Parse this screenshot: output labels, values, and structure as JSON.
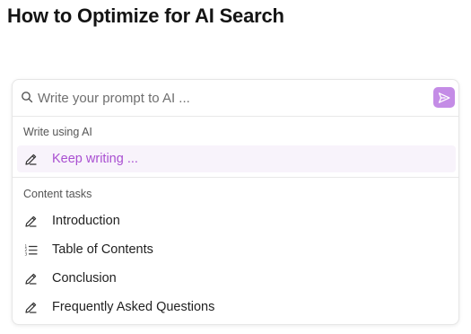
{
  "document": {
    "title": "How to Optimize for AI Search"
  },
  "prompt": {
    "placeholder": "Write your prompt to AI ..."
  },
  "sections": {
    "write_using_ai": {
      "label": "Write using AI",
      "items": [
        {
          "label": "Keep writing ...",
          "icon": "pencil-icon"
        }
      ]
    },
    "content_tasks": {
      "label": "Content tasks",
      "items": [
        {
          "label": "Introduction",
          "icon": "pencil-icon"
        },
        {
          "label": "Table of Contents",
          "icon": "list-icon"
        },
        {
          "label": "Conclusion",
          "icon": "pencil-icon"
        },
        {
          "label": "Frequently Asked Questions",
          "icon": "pencil-icon"
        }
      ]
    }
  },
  "colors": {
    "accent": "#c48ce6",
    "accent_text": "#a94fd1",
    "highlight_bg": "#f8f3fb"
  }
}
